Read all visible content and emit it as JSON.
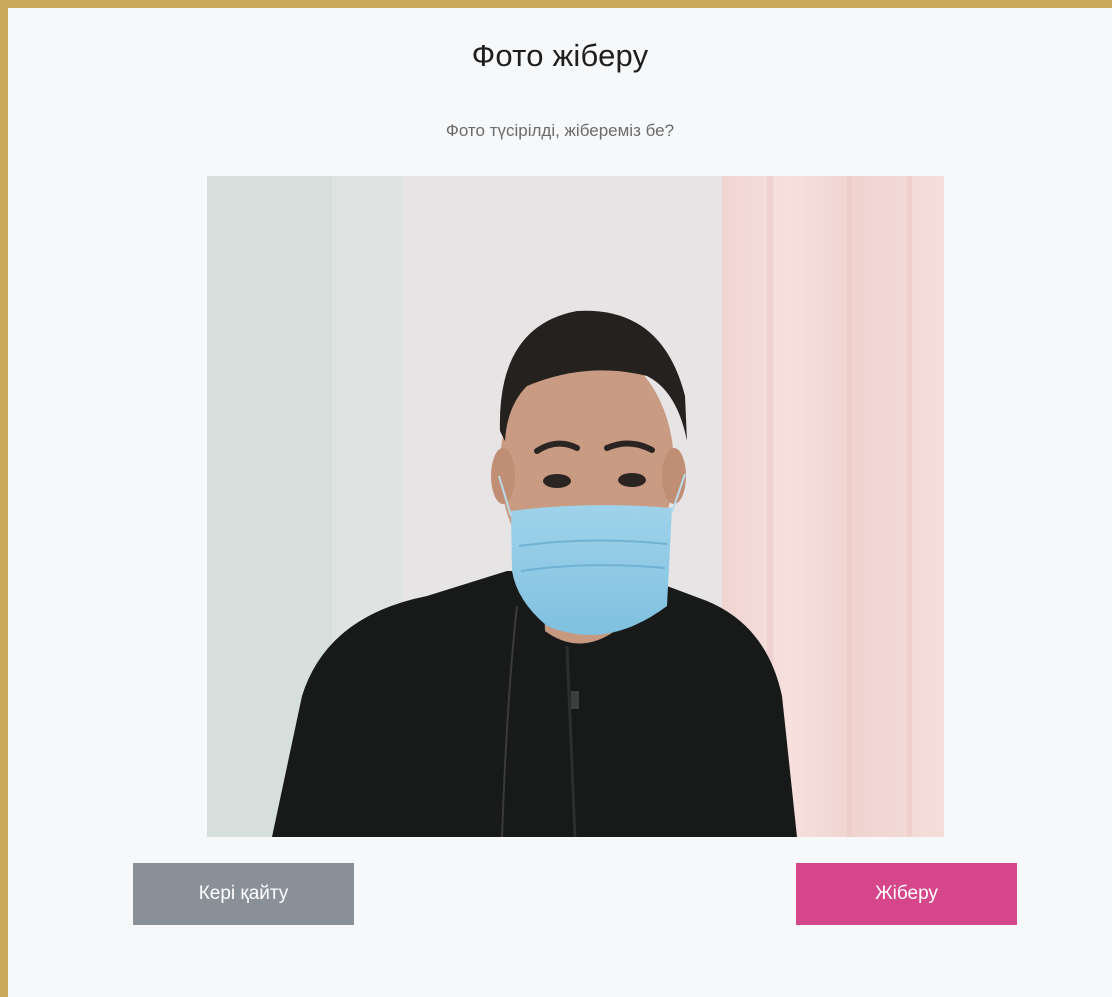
{
  "page": {
    "title": "Фото жіберу",
    "subtitle": "Фото түсірілді, жібереміз бе?"
  },
  "photo": {
    "description_icon": "captured-photo"
  },
  "actions": {
    "back_label": "Кері қайту",
    "send_label": "Жіберу"
  },
  "colors": {
    "frame": "#c9a95c",
    "background": "#f6f8fa",
    "back_button": "#8a9098",
    "send_button": "#d6468a"
  }
}
